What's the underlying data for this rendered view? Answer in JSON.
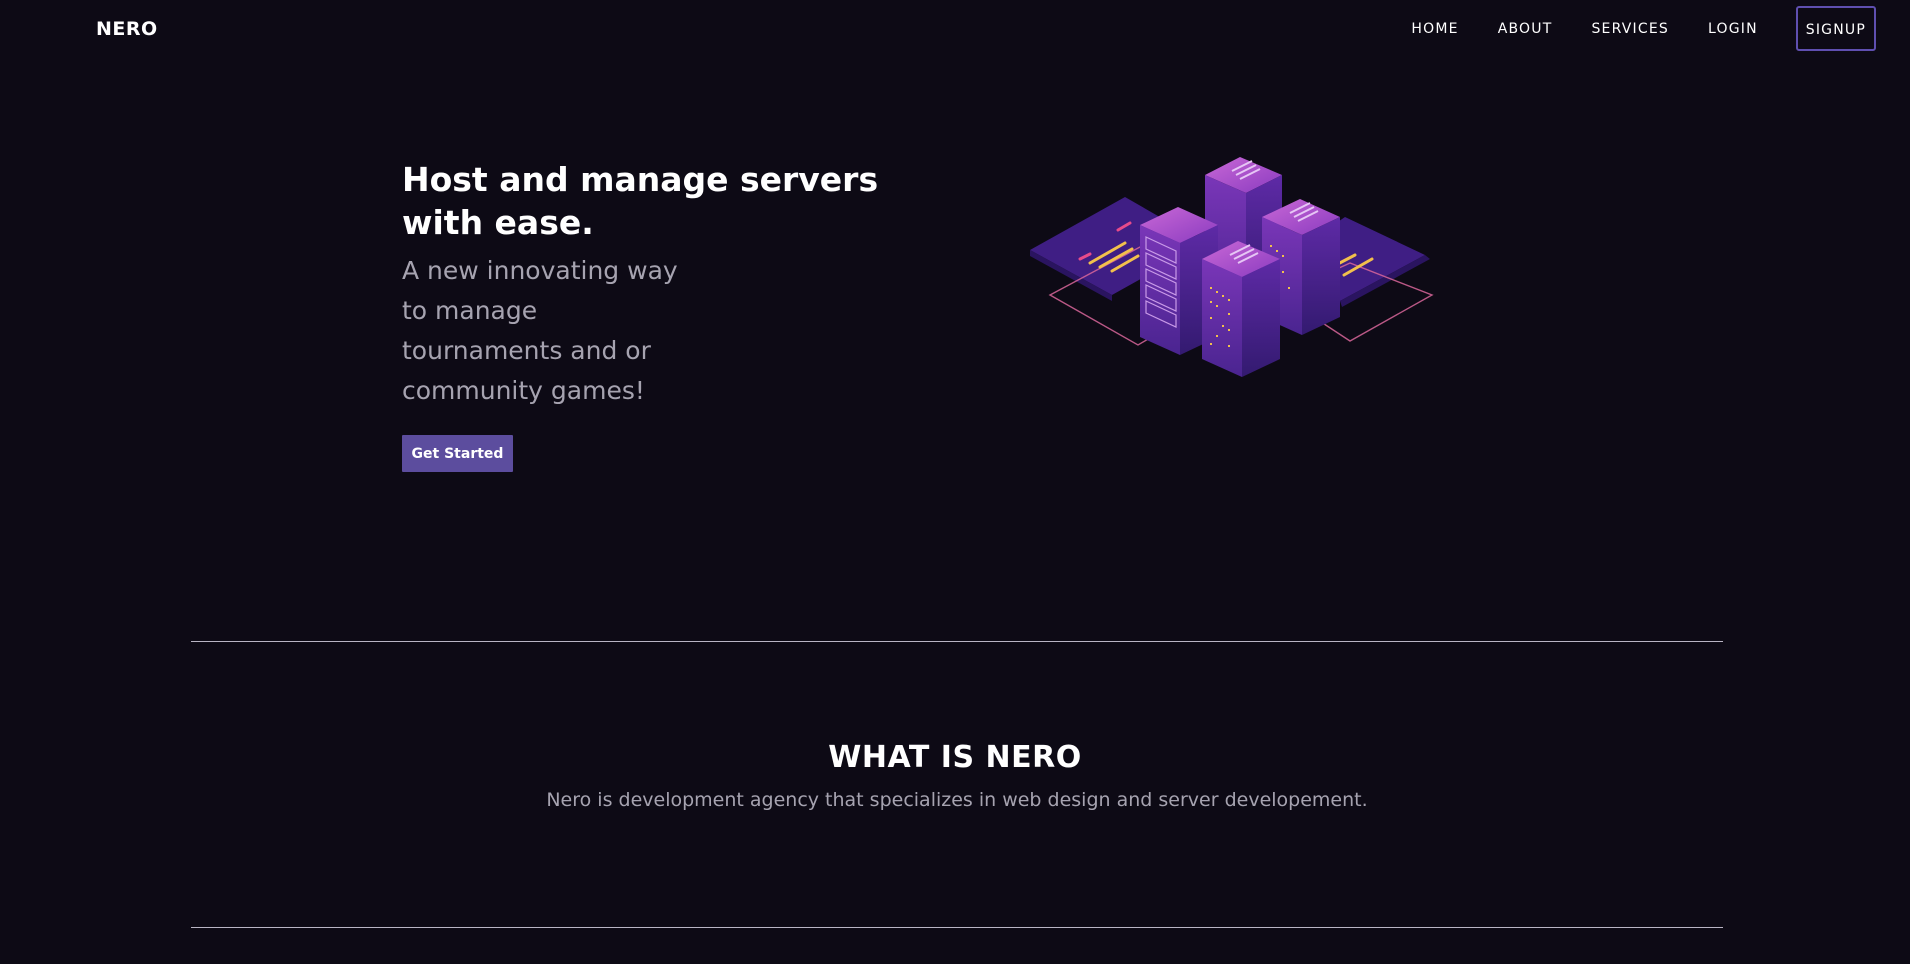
{
  "brand": {
    "name": "NERO"
  },
  "nav": {
    "items": [
      {
        "label": "HOME"
      },
      {
        "label": "ABOUT"
      },
      {
        "label": "SERVICES"
      },
      {
        "label": "LOGIN"
      }
    ],
    "signup_label": "SIGNUP"
  },
  "hero": {
    "title": "Host and manage servers with ease.",
    "subtitle": "A new innovating way to manage tournaments and or community games!",
    "cta_label": "Get Started",
    "illustration_icon": "isometric-server-racks-illustration"
  },
  "about": {
    "title": "WHAT IS NERO",
    "text": "Nero is development agency that specializes in web design and server developement."
  },
  "colors": {
    "background": "#0d0a15",
    "accent": "#5c4d9e",
    "signup_border": "#5f4fb0",
    "muted_text": "#a6a3b0",
    "divider": "#b9b5c4"
  }
}
